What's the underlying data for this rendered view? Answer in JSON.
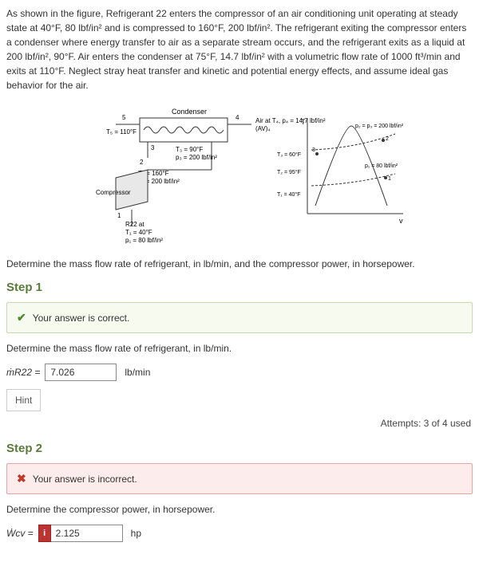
{
  "problem": "As shown in the figure, Refrigerant 22 enters the compressor of an air conditioning unit operating at steady state at 40°F, 80 lbf/in² and is compressed to 160°F, 200 lbf/in². The refrigerant exiting the compressor enters a condenser where energy transfer to air as a separate stream occurs, and the refrigerant exits as a liquid at 200 lbf/in², 90°F. Air enters the condenser at 75°F, 14.7 lbf/in² with a volumetric flow rate of 1000 ft³/min and exits at 110°F. Neglect stray heat transfer and kinetic and potential energy effects, and assume ideal gas behavior for the air.",
  "figure": {
    "condenser_label": "Condenser",
    "compressor_label": "Compressor",
    "air_in": "Air at T₄, p₄ = 14.7 lbf/in²",
    "av4": "(AV)₄",
    "state5": "5",
    "T5": "T₅ = 110°F",
    "T3": "T₃ = 90°F",
    "p3": "p₃ = 200 lbf/in²",
    "T2": "T₂ = 160°F",
    "p2": "p₂ = 200 lbf/in²",
    "state1": "1",
    "R22": "R22 at",
    "T1": "T₁ = 40°F",
    "p1": "p₁ = 80 lbf/in²",
    "chart": {
      "T_label": "T",
      "v_label": "v",
      "T3_mark": "T₃ = 60°F",
      "T2_mark": "T₂ = 95°F",
      "T1_mark": "T₁ = 40°F",
      "p_high": "p₂ = p₃ = 200 lbf/in²",
      "p_low": "p₁ = 80 lbf/in²"
    }
  },
  "question": "Determine the mass flow rate of refrigerant, in lb/min, and the compressor power, in horsepower.",
  "step1": {
    "title": "Step 1",
    "feedback": "Your answer is correct.",
    "prompt": "Determine the mass flow rate of refrigerant, in lb/min.",
    "var": "ṁR22 =",
    "value": "7.026",
    "unit": "lb/min",
    "hint": "Hint"
  },
  "attempts": "Attempts: 3 of 4 used",
  "step2": {
    "title": "Step 2",
    "feedback": "Your answer is incorrect.",
    "prompt": "Determine the compressor power, in horsepower.",
    "var": "Ẇcv =",
    "badge": "i",
    "value": "2.125",
    "unit": "hp"
  }
}
